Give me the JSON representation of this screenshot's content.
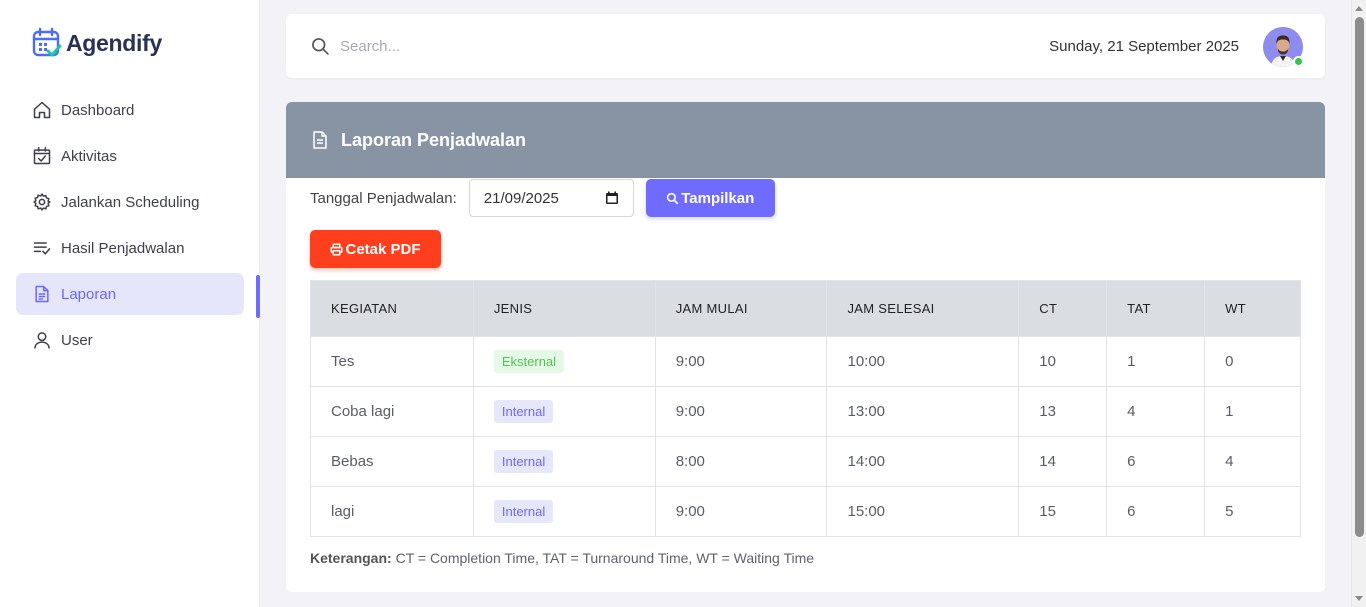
{
  "app": {
    "name": "Agendify"
  },
  "sidebar": {
    "items": [
      {
        "label": "Dashboard",
        "icon": "home-icon",
        "active": false
      },
      {
        "label": "Aktivitas",
        "icon": "calendar-check-icon",
        "active": false
      },
      {
        "label": "Jalankan Scheduling",
        "icon": "gear-icon",
        "active": false
      },
      {
        "label": "Hasil Penjadwalan",
        "icon": "list-check-icon",
        "active": false
      },
      {
        "label": "Laporan",
        "icon": "document-icon",
        "active": true
      },
      {
        "label": "User",
        "icon": "user-icon",
        "active": false
      }
    ]
  },
  "header": {
    "search_placeholder": "Search...",
    "date": "Sunday, 21 September 2025"
  },
  "report": {
    "title": "Laporan Penjadwalan",
    "filter_label": "Tanggal Penjadwalan:",
    "date_value": "21/09/2025",
    "show_label": "Tampilkan",
    "pdf_label": "Cetak PDF",
    "columns": [
      "KEGIATAN",
      "JENIS",
      "JAM MULAI",
      "JAM SELESAI",
      "CT",
      "TAT",
      "WT"
    ],
    "rows": [
      {
        "kegiatan": "Tes",
        "jenis": "Eksternal",
        "jam_mulai": "9:00",
        "jam_selesai": "10:00",
        "ct": "10",
        "tat": "1",
        "wt": "0"
      },
      {
        "kegiatan": "Coba lagi",
        "jenis": "Internal",
        "jam_mulai": "9:00",
        "jam_selesai": "13:00",
        "ct": "13",
        "tat": "4",
        "wt": "1"
      },
      {
        "kegiatan": "Bebas",
        "jenis": "Internal",
        "jam_mulai": "8:00",
        "jam_selesai": "14:00",
        "ct": "14",
        "tat": "6",
        "wt": "4"
      },
      {
        "kegiatan": "lagi",
        "jenis": "Internal",
        "jam_mulai": "9:00",
        "jam_selesai": "15:00",
        "ct": "15",
        "tat": "6",
        "wt": "5"
      }
    ],
    "note_label": "Keterangan:",
    "note_text": " CT = Completion Time, TAT = Turnaround Time, WT = Waiting Time"
  },
  "colors": {
    "accent": "#6f6bff",
    "danger": "#ff3e1d",
    "header_bg": "#8893a4",
    "badge_external": "#52c452",
    "badge_internal": "#6b68ff"
  }
}
